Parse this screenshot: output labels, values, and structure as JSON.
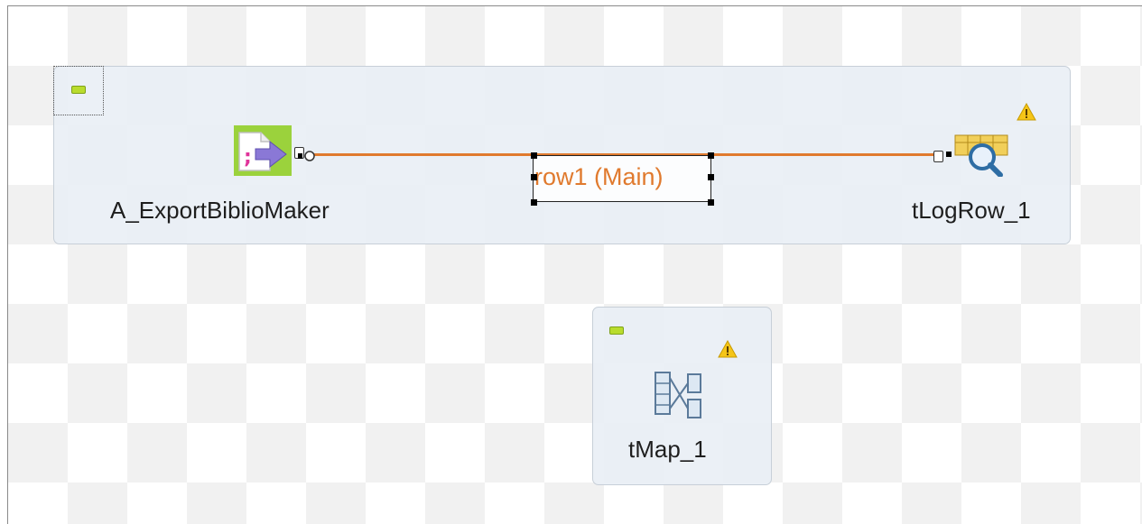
{
  "components": {
    "input": {
      "label": "A_ExportBiblioMaker",
      "icon": "file-delimited-input-icon"
    },
    "output": {
      "label": "tLogRow_1",
      "icon": "log-row-magnifier-icon"
    },
    "map": {
      "label": "tMap_1",
      "icon": "tmap-icon"
    }
  },
  "connection": {
    "label": "row1 (Main)",
    "color": "#e07a2e"
  },
  "colors": {
    "subjob_bg": "#e8eef5",
    "collapse_button": "#b9dc2d",
    "warning": "#f5c518"
  }
}
